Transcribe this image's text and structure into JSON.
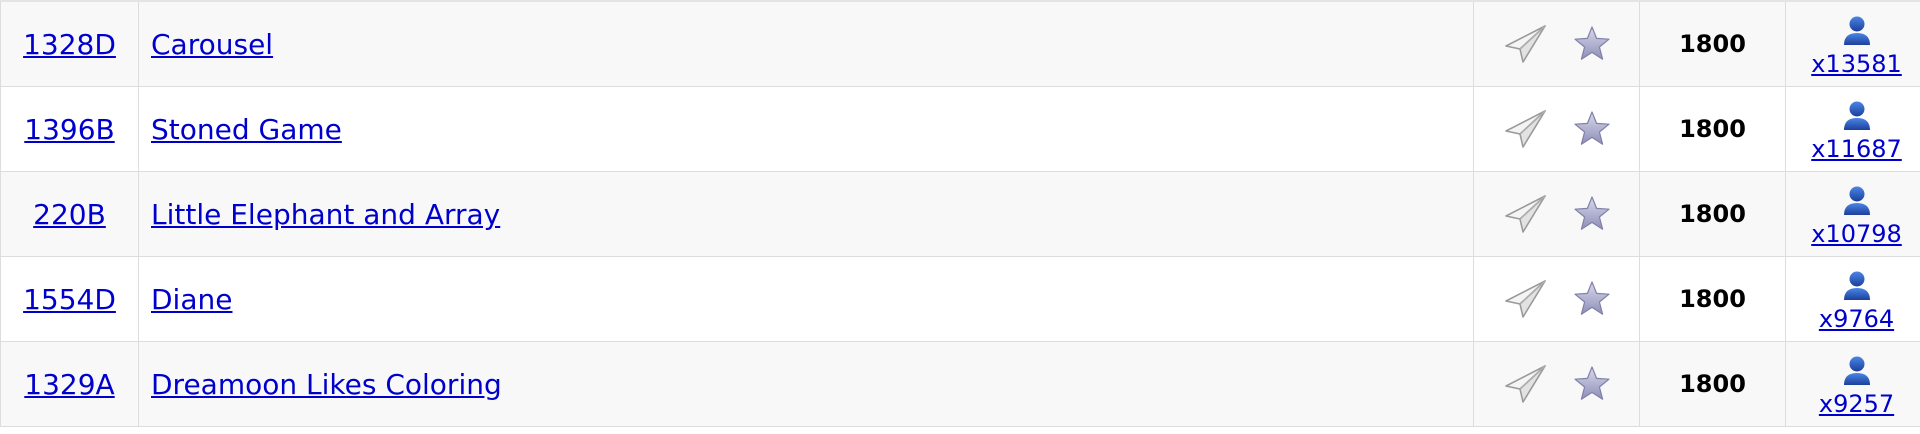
{
  "problems": [
    {
      "id": "1328D",
      "name": "Carousel",
      "rating": "1800",
      "solved": "x13581"
    },
    {
      "id": "1396B",
      "name": "Stoned Game",
      "rating": "1800",
      "solved": "x11687"
    },
    {
      "id": "220B",
      "name": "Little Elephant and Array",
      "rating": "1800",
      "solved": "x10798"
    },
    {
      "id": "1554D",
      "name": "Diane",
      "rating": "1800",
      "solved": "x9764"
    },
    {
      "id": "1329A",
      "name": "Dreamoon Likes Coloring",
      "rating": "1800",
      "solved": "x9257"
    }
  ],
  "icons": {
    "submit": "paper-plane-icon",
    "favourite": "star-icon",
    "solved_by": "user-icon"
  },
  "colors": {
    "link": "#0000cc",
    "row_alt": "#f8f8f8",
    "border": "#dddddd"
  }
}
